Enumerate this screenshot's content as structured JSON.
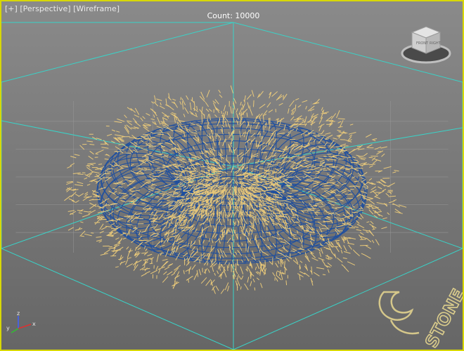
{
  "viewport": {
    "labels": [
      "[+]",
      "[Perspective]",
      "[Wireframe]"
    ],
    "count_label": "Count: 10000"
  },
  "viewcube": {
    "face_label": "FRONT",
    "side_label": "RIGHT"
  },
  "axis": {
    "x": "x",
    "y": "y",
    "z": "z"
  },
  "watermark": {
    "text": "STONE"
  },
  "colors": {
    "border": "#d8d800",
    "grid": "#9a9a9a",
    "guide": "#39d3c8",
    "torus": "#1e4fa0",
    "particles": "#f5d27a"
  }
}
